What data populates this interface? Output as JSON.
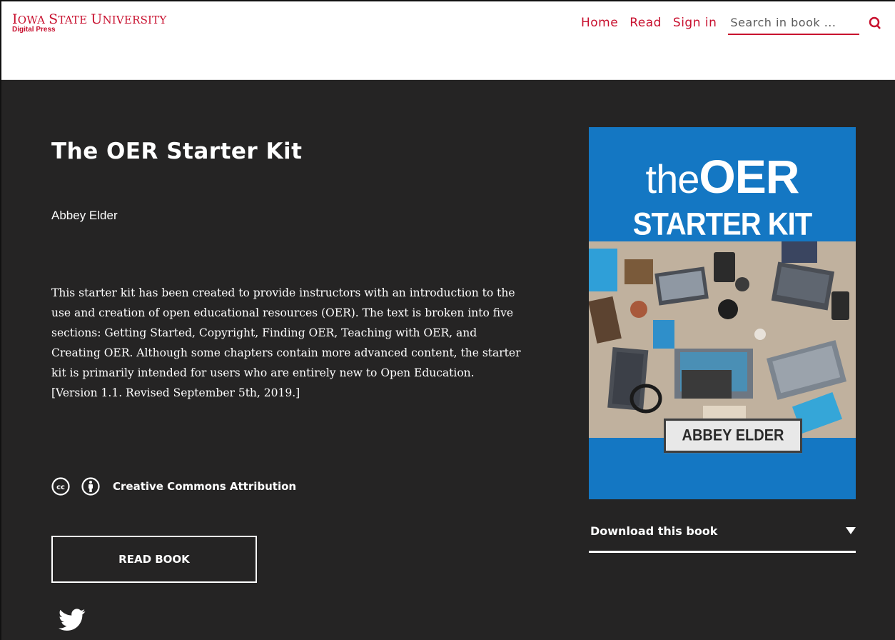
{
  "header": {
    "logo_first_letter": "I",
    "logo_main_rest": "OWA",
    "logo_main_state": "S",
    "logo_main_state_rest": "TATE",
    "logo_main_univ": "U",
    "logo_main_univ_rest": "NIVERSITY",
    "logo_sub": "Digital Press",
    "nav": {
      "home": "Home",
      "read": "Read",
      "sign_in": "Sign in"
    },
    "search": {
      "placeholder": "Search in book ..."
    }
  },
  "book": {
    "title": "The OER Starter Kit",
    "author": "Abbey Elder",
    "description": "This starter kit has been created to provide instructors with an introduction to the use and creation of open educational resources (OER). The text is broken into five sections: Getting Started, Copyright, Finding OER, Teaching with OER, and Creating OER. Although some chapters contain more advanced content, the starter kit is primarily intended for users who are entirely new to Open Education. [Version 1.1. Revised September 5th, 2019.]",
    "license_label": "Creative Commons Attribution",
    "license_icons": [
      "cc-icon",
      "attribution-icon"
    ],
    "read_button": "READ BOOK",
    "share_icon": "twitter-icon"
  },
  "cover": {
    "the": "the",
    "oer": "OER",
    "starter_kit": "STARTER KIT",
    "author": "ABBEY ELDER"
  },
  "download": {
    "label": "Download this book"
  },
  "colors": {
    "brand_red": "#c8102e",
    "hero_bg": "#252424",
    "cover_blue": "#1477c3"
  }
}
